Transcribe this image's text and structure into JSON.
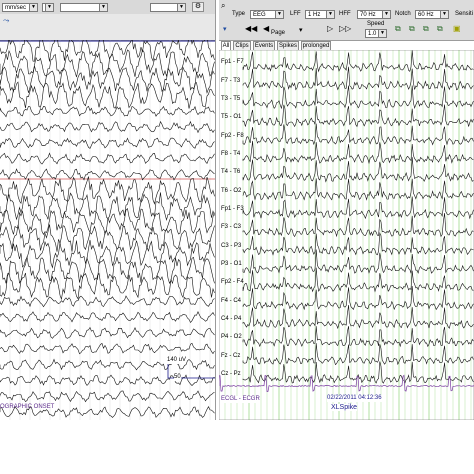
{
  "left": {
    "speed_value": "mm/sec",
    "scale_label": "140 uV",
    "bottom_left": "50",
    "onset_text": "OGRAPHIC ONSET"
  },
  "right": {
    "type_label": "Type",
    "type_value": "EEG",
    "lff_label": "LFF",
    "lff_value": "1 Hz",
    "hff_label": "HFF",
    "hff_value": "70 Hz",
    "notch_label": "Notch",
    "notch_value": "60 Hz",
    "sensitivity_label": "Sensiti",
    "page_label": "Page",
    "speed_label": "Speed",
    "speed_value": "1.0",
    "tabs": [
      "All",
      "Clips",
      "Events",
      "Spikes",
      "prolonged"
    ],
    "channels": [
      "Fp1 - F7",
      "F7 - T3",
      "T3 - T5",
      "T5 - O1",
      "Fp2 - F8",
      "F8 - T4",
      "T4 - T6",
      "T6 - O2",
      "Fp1 - F3",
      "F3 - C3",
      "C3 - P3",
      "P3 - O1",
      "Fp2 - F4",
      "F4 - C4",
      "C4 - P4",
      "P4 - O2",
      "Fz - Cz",
      "Cz - Pz"
    ],
    "ecg_label": "ECGL - ECGR",
    "timestamp": "02/22/2011 04:12:36",
    "event_label": "XLSpike"
  },
  "colors": {
    "grid_green": "#bfe6b0",
    "trace": "#111111",
    "ecg_trace": "#7a3fa0",
    "marker_red": "#c00000",
    "toolbar": "#d9d9d9"
  },
  "icons": [
    "cursor-icon",
    "play-back-fast-icon",
    "play-back-icon",
    "play-forward-icon",
    "play-forward-fast-icon",
    "settings-icon"
  ]
}
